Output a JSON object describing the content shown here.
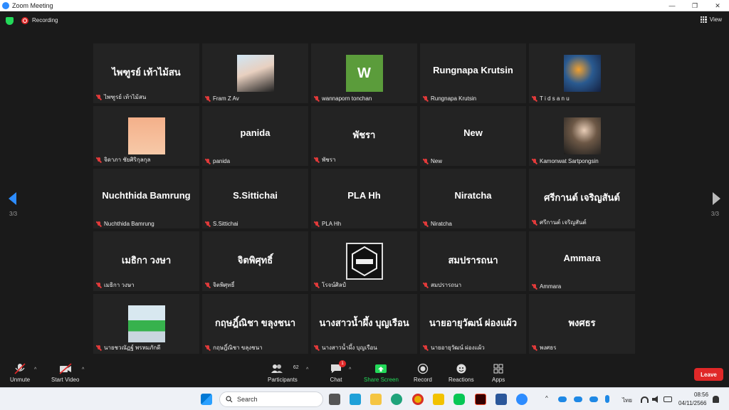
{
  "window": {
    "title": "Zoom Meeting",
    "minimize": "—",
    "maximize": "❐",
    "close": "✕"
  },
  "topbar": {
    "recording_label": "Recording",
    "view_label": "View"
  },
  "gallery": {
    "page_indicator_left": "3/3",
    "page_indicator_right": "3/3",
    "tiles": [
      {
        "display": "ไพฑูรย์ เท้าไม้สน",
        "nameplate": "ไพฑูรย์ เท้าไม้สน",
        "type": "name"
      },
      {
        "display": "",
        "nameplate": "Fram Z Av",
        "type": "photo"
      },
      {
        "display": "W",
        "nameplate": "wannaporn tonchan",
        "type": "letter"
      },
      {
        "display": "Rungnapa Krutsin",
        "nameplate": "Rungnapa Krutsin",
        "type": "name"
      },
      {
        "display": "",
        "nameplate": "T i d s a n u",
        "type": "photo"
      },
      {
        "display": "",
        "nameplate": "จิดาภา ชัยศิริกุลกุล",
        "type": "photo"
      },
      {
        "display": "panida",
        "nameplate": "panida",
        "type": "name"
      },
      {
        "display": "พัชรา",
        "nameplate": "พัชรา",
        "type": "name"
      },
      {
        "display": "New",
        "nameplate": "New",
        "type": "name"
      },
      {
        "display": "",
        "nameplate": "Kamonwat Sartpongsin",
        "type": "photo"
      },
      {
        "display": "Nuchthida Bamrung",
        "nameplate": "Nuchthida Bamrung",
        "type": "name"
      },
      {
        "display": "S.Sittichai",
        "nameplate": "S.Sittichai",
        "type": "name"
      },
      {
        "display": "PLA Hh",
        "nameplate": "PLA Hh",
        "type": "name"
      },
      {
        "display": "Niratcha",
        "nameplate": "Niratcha",
        "type": "name"
      },
      {
        "display": "ศรีกานต์ เจริญสันต์",
        "nameplate": "ศรีกานต์ เจริญสันต์",
        "type": "name"
      },
      {
        "display": "เมธิกา วงษา",
        "nameplate": "เมธิกา วงษา",
        "type": "name"
      },
      {
        "display": "จิตพิศุทธิ์",
        "nameplate": "จิตพิศุทธิ์",
        "type": "name"
      },
      {
        "display": "",
        "nameplate": "โรจน์ศิลป์",
        "type": "logo"
      },
      {
        "display": "สมปรารถนา",
        "nameplate": "สมปรารถนา",
        "type": "name"
      },
      {
        "display": "Ammara",
        "nameplate": "Ammara",
        "type": "name"
      },
      {
        "display": "",
        "nameplate": "นายชวณัฏฐ์ พรหมภักดี",
        "type": "photo"
      },
      {
        "display": "กฤษฎิ์ณิชา ขลุงชนา",
        "nameplate": "กฤษฎิ์ณิชา ขลุงชนา",
        "type": "name"
      },
      {
        "display": "นางสาวน้ำผึ้ง บุญเรือน",
        "nameplate": "นางสาวน้ำผึ้ง บุญเรือน",
        "type": "name"
      },
      {
        "display": "นายอายุวัฒน์ ผ่องแผ้ว",
        "nameplate": "นายอายุวัฒน์ ผ่องแผ้ว",
        "type": "name"
      },
      {
        "display": "พงศธร",
        "nameplate": "พงศธร",
        "type": "name"
      }
    ]
  },
  "toolbar": {
    "unmute": "Unmute",
    "start_video": "Start Video",
    "participants": "Participants",
    "participants_count": "62",
    "chat": "Chat",
    "chat_badge": "1",
    "share_screen": "Share Screen",
    "record": "Record",
    "reactions": "Reactions",
    "apps": "Apps",
    "leave": "Leave",
    "share_color": "#23d959",
    "leave_color": "#e02828"
  },
  "taskbar": {
    "search_placeholder": "Search",
    "lang": "ไทย",
    "time": "08:56",
    "date": "04/11/2566"
  }
}
